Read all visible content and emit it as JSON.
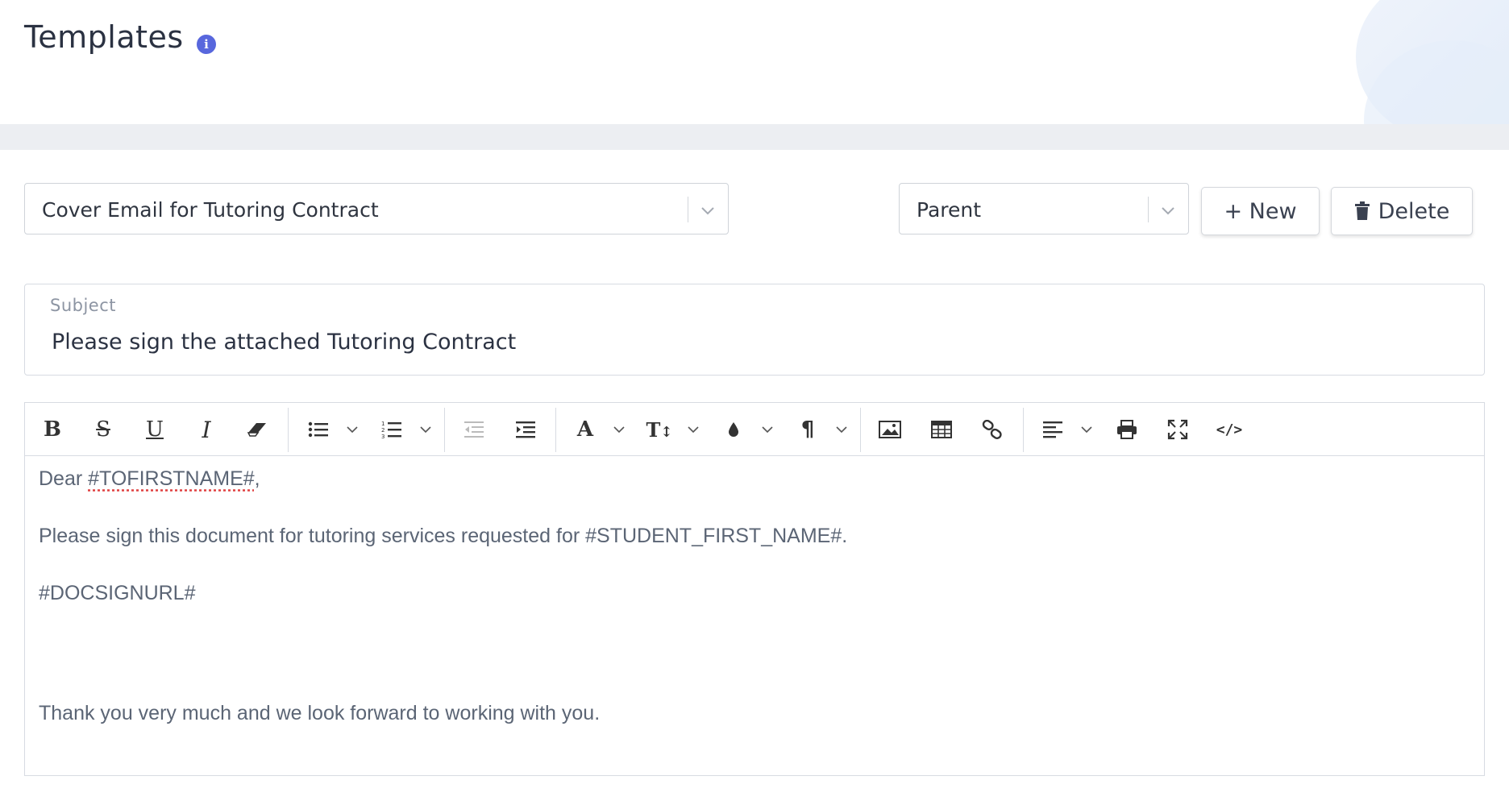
{
  "header": {
    "title": "Templates",
    "info_icon": "info-icon"
  },
  "template_select": {
    "value": "Cover Email for Tutoring Contract",
    "icon": "chevron-down-icon"
  },
  "audience_select": {
    "value": "Parent",
    "icon": "chevron-down-icon"
  },
  "actions": {
    "new_label": "+ New",
    "delete_label": "Delete",
    "delete_icon": "trash-icon"
  },
  "subject": {
    "label": "Subject",
    "value": "Please sign the attached Tutoring Contract"
  },
  "toolbar": {
    "buttons": [
      "bold",
      "strikethrough",
      "underline",
      "italic",
      "clear-format",
      "unordered-list",
      "ordered-list",
      "outdent",
      "indent",
      "font-family",
      "font-size",
      "color",
      "paragraph-style",
      "picture",
      "table",
      "link",
      "align",
      "print",
      "fullscreen",
      "code-view"
    ]
  },
  "body": {
    "greeting_prefix": "Dear ",
    "greeting_token": "#TOFIRSTNAME#",
    "greeting_suffix": ",",
    "line2": "Please sign this document for tutoring services requested for #STUDENT_FIRST_NAME#.",
    "line3": "#DOCSIGNURL#",
    "line4": "Thank you very much and we look forward to working with you."
  },
  "colors": {
    "accent": "#5867dd",
    "text": "#2b3242",
    "muted": "#8d95a3"
  }
}
